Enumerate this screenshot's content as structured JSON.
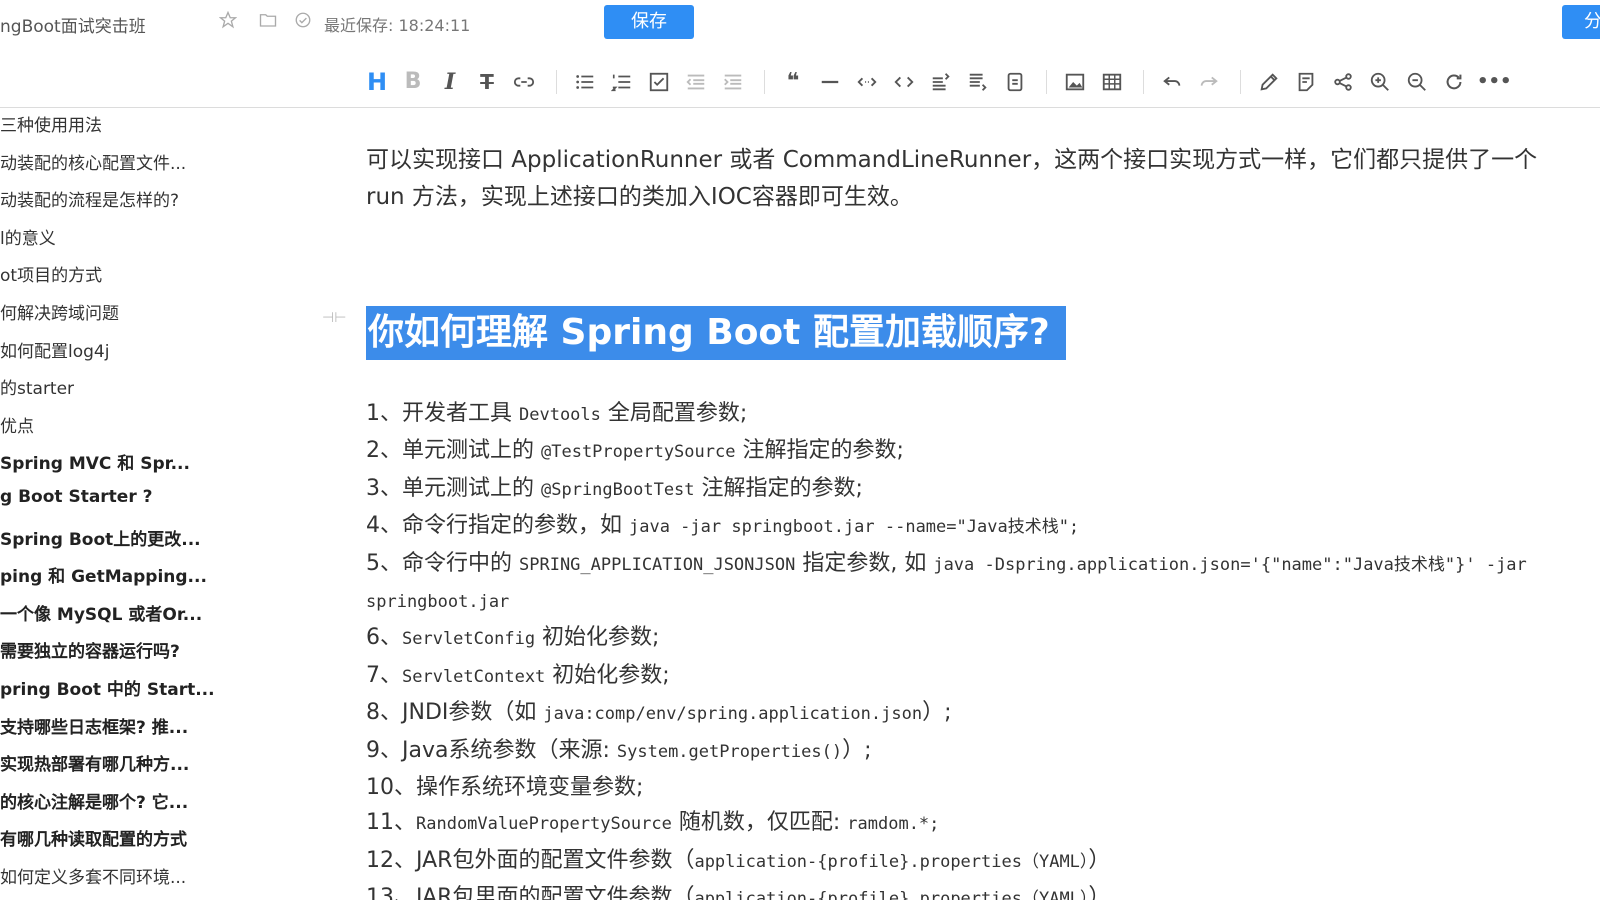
{
  "header": {
    "doc_title": "ngBoot面试突击班",
    "save_status": "最近保存: 18:24:11",
    "save_label": "保存",
    "share_label": "分"
  },
  "toolbar": {
    "icons": [
      "heading-icon",
      "bold-icon",
      "italic-icon",
      "strikethrough-icon",
      "link-icon",
      "bullet-list-icon",
      "ordered-list-icon",
      "task-list-icon",
      "outdent-icon",
      "indent-icon",
      "quote-icon",
      "hr-icon",
      "inline-code-icon",
      "code-block-icon",
      "insert-before-icon",
      "insert-after-icon",
      "table-of-contents-icon",
      "image-icon",
      "table-icon",
      "undo-icon",
      "redo-icon",
      "edit-icon",
      "export-icon",
      "mindmap-icon",
      "zoom-in-icon",
      "zoom-out-icon",
      "refresh-icon",
      "more-icon"
    ]
  },
  "sidebar": {
    "items": [
      {
        "label": "三种使用用法",
        "bold": false
      },
      {
        "label": "动装配的核心配置文件...",
        "bold": false
      },
      {
        "label": "动装配的流程是怎样的?",
        "bold": false
      },
      {
        "label": "l的意义",
        "bold": false
      },
      {
        "label": "ot项目的方式",
        "bold": false
      },
      {
        "label": "何解决跨域问题",
        "bold": false
      },
      {
        "label": "如何配置log4j",
        "bold": false
      },
      {
        "label": "的starter",
        "bold": false
      },
      {
        "label": "优点",
        "bold": false
      },
      {
        "label": "Spring MVC 和 Spr...",
        "bold": true
      },
      {
        "label": "g Boot Starter ?",
        "bold": true
      },
      {
        "label": "Spring Boot上的更改...",
        "bold": true
      },
      {
        "label": "ping 和 GetMapping...",
        "bold": true
      },
      {
        "label": "一个像 MySQL 或者Or...",
        "bold": true
      },
      {
        "label": "需要独立的容器运行吗?",
        "bold": true
      },
      {
        "label": "pring Boot 中的 Start...",
        "bold": true
      },
      {
        "label": "支持哪些日志框架? 推...",
        "bold": true
      },
      {
        "label": "实现热部署有哪几种方...",
        "bold": true
      },
      {
        "label": "的核心注解是哪个? 它...",
        "bold": true
      },
      {
        "label": "有哪几种读取配置的方式",
        "bold": true
      },
      {
        "label": "如何定义多套不同环境...",
        "bold": false
      }
    ]
  },
  "content": {
    "paragraph": "可以实现接口 ApplicationRunner 或者 CommandLineRunner，这两个接口实现方式一样，它们都只提供了一个 run 方法，实现上述接口的类加入IOC容器即可生效。",
    "heading": "你如何理解 Spring Boot 配置加载顺序?",
    "list": [
      {
        "num": "1、",
        "text1": "开发者工具 ",
        "code1": "Devtools",
        "text2": " 全局配置参数;"
      },
      {
        "num": "2、",
        "text1": "单元测试上的 ",
        "code1": "@TestPropertySource",
        "text2": " 注解指定的参数;"
      },
      {
        "num": "3、",
        "text1": "单元测试上的 ",
        "code1": "@SpringBootTest",
        "text2": " 注解指定的参数;"
      },
      {
        "num": "4、",
        "text1": "命令行指定的参数，如 ",
        "code1": "java -jar springboot.jar --name=\"Java技术栈\";",
        "text2": ""
      },
      {
        "num": "5、",
        "text1": "命令行中的 ",
        "code1": "SPRING_APPLICATION_JSONJSON",
        "text2": " 指定参数, 如 ",
        "code2": "java -Dspring.application.json='{\"name\":\"Java技术栈\"}' -jar springboot.jar"
      },
      {
        "num": "6、",
        "text1": "",
        "code1": "ServletConfig",
        "text2": " 初始化参数;"
      },
      {
        "num": "7、",
        "text1": "",
        "code1": "ServletContext",
        "text2": " 初始化参数;"
      },
      {
        "num": "8、",
        "text1": "JNDI参数（如 ",
        "code1": "java:comp/env/spring.application.json",
        "text2": "）;"
      },
      {
        "num": "9、",
        "text1": "Java系统参数（来源: ",
        "code1": "System.getProperties()",
        "text2": "）;"
      },
      {
        "num": "10、",
        "text1": "操作系统环境变量参数;",
        "code1": "",
        "text2": ""
      },
      {
        "num": "11、",
        "text1": "",
        "code1": "RandomValuePropertySource",
        "text2": " 随机数，仅匹配: ",
        "code2": "ramdom.*;"
      },
      {
        "num": "12、",
        "text1": "JAR包外面的配置文件参数（",
        "code1": "application-{profile}.properties（YAML）",
        "text2": "）"
      },
      {
        "num": "13、",
        "text1": "JAR包里面的配置文件参数（",
        "code1": "application-{profile}.properties（YAML）",
        "text2": "）"
      }
    ]
  },
  "colors": {
    "accent": "#2f8ef4",
    "heading_highlight": "#3c8cea"
  }
}
